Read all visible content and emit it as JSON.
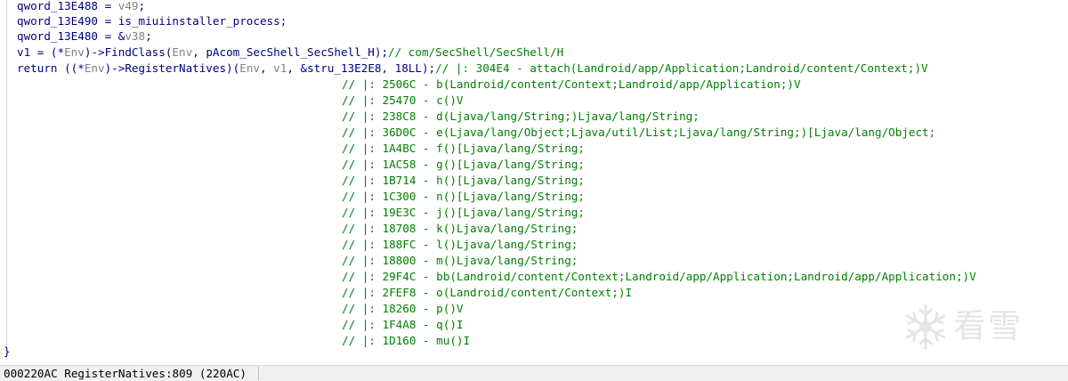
{
  "code": {
    "lines": [
      {
        "lhs": "qword_13E488",
        "op": " = ",
        "rhs": "v49",
        "tail": ";"
      },
      {
        "lhs": "qword_13E490",
        "op": " = ",
        "rhs": "is_miuiinstaller_process",
        "tail": ";"
      },
      {
        "lhs": "qword_13E480",
        "op": " = &",
        "rhs": "v38",
        "tail": ";"
      },
      {
        "prefix": "v1 = (*",
        "env": "Env",
        "mid": ")->FindClass(",
        "env2": "Env",
        "args": ", pAcom_SecShell_SecShell_H);",
        "comment": "// com/SecShell/SecShell/H"
      },
      {
        "prefix": "return ((*",
        "env": "Env",
        "mid": ")->RegisterNatives)(",
        "env2": "Env",
        "args_a": ", ",
        "v1": "v1",
        "args_b": ", &stru_13E2E8, 18LL);",
        "comment": "// |: 304E4 - attach(Landroid/app/Application;Landroid/content/Context;)V"
      }
    ],
    "comments": [
      "// |: 2506C - b(Landroid/content/Context;Landroid/app/Application;)V",
      "// |: 25470 - c()V",
      "// |: 238C8 - d(Ljava/lang/String;)Ljava/lang/String;",
      "// |: 36D0C - e(Ljava/lang/Object;Ljava/util/List;Ljava/lang/String;)[Ljava/lang/Object;",
      "// |: 1A4BC - f()[Ljava/lang/String;",
      "// |: 1AC58 - g()[Ljava/lang/String;",
      "// |: 1B714 - h()[Ljava/lang/String;",
      "// |: 1C300 - n()[Ljava/lang/String;",
      "// |: 19E3C - j()[Ljava/lang/String;",
      "// |: 18708 - k()Ljava/lang/String;",
      "// |: 188FC - l()Ljava/lang/String;",
      "// |: 18800 - m()Ljava/lang/String;",
      "// |: 29F4C - bb(Landroid/content/Context;Landroid/app/Application;Landroid/app/Application;)V",
      "// |: 2FEF8 - o(Landroid/content/Context;)I",
      "// |: 18260 - p()V",
      "// |: 1F4A8 - q()I",
      "// |: 1D160 - mu()I"
    ],
    "closing_brace": "}"
  },
  "statusbar": {
    "text": "000220AC RegisterNatives:809 (220AC)"
  },
  "watermark": {
    "icon": "snowflake-icon",
    "text": "看雪"
  },
  "colors": {
    "identifier": "#000080",
    "variable": "#808080",
    "comment": "#008000",
    "statusbar_bg": "#f0f0f0"
  }
}
